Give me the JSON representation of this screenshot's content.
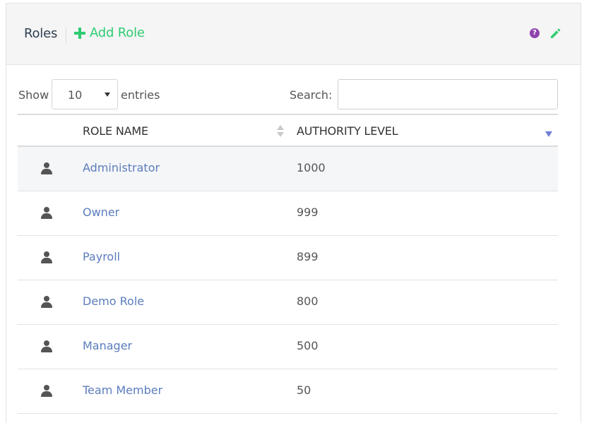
{
  "header": {
    "title": "Roles",
    "add_role_label": "Add Role",
    "help_icon_glyph": "?",
    "help_color": "#8e44ad",
    "accent_color": "#2ecc71"
  },
  "controls": {
    "show_label": "Show",
    "page_length": "10",
    "entries_label": "entries",
    "search_label": "Search:",
    "search_value": ""
  },
  "table": {
    "columns": [
      "ROLE NAME",
      "AUTHORITY LEVEL"
    ],
    "sort": {
      "column": "AUTHORITY LEVEL",
      "direction": "descending"
    },
    "rows": [
      {
        "icon": "user-icon",
        "name": "Administrator",
        "level": "1000"
      },
      {
        "icon": "user-icon",
        "name": "Owner",
        "level": "999"
      },
      {
        "icon": "user-icon",
        "name": "Payroll",
        "level": "899"
      },
      {
        "icon": "user-icon",
        "name": "Demo Role",
        "level": "800"
      },
      {
        "icon": "user-icon",
        "name": "Manager",
        "level": "500"
      },
      {
        "icon": "user-icon",
        "name": "Team Member",
        "level": "50"
      }
    ]
  },
  "colors": {
    "link": "#5b7cbd",
    "header_bg": "#f5f5f5",
    "striped_row": "#f5f6f8",
    "sort_indicator": "#6f7fd8"
  }
}
